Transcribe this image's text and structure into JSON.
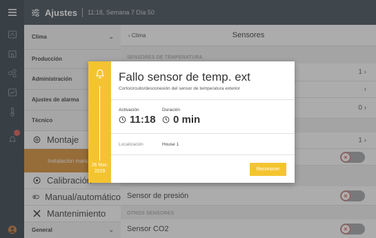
{
  "header": {
    "title": "Ajustes",
    "subtitle": "11:18, Semana 7 Día 50"
  },
  "menu": {
    "items": [
      {
        "label": "Clima"
      },
      {
        "label": "Producción"
      },
      {
        "label": "Administración"
      },
      {
        "label": "Ajustes de alarma"
      },
      {
        "label": "Técnico"
      }
    ],
    "tech_items": [
      {
        "label": "Montaje",
        "icon": "gear-icon"
      },
      {
        "label": "Instalación manual",
        "active": true
      },
      {
        "label": "Calibración",
        "icon": "crosshair-icon"
      },
      {
        "label": "Manual/automático",
        "icon": "toggle-icon"
      },
      {
        "label": "Mantenimiento",
        "icon": "tools-icon"
      }
    ],
    "general": {
      "label": "General"
    }
  },
  "main": {
    "back_label": "Clima",
    "title": "Sensores",
    "section_temp": "SENSORES DE TEMPERATURA",
    "temp_rows": [
      {
        "value": "1"
      },
      {
        "value": ""
      },
      {
        "value": "0"
      }
    ],
    "row_b_value": "1",
    "pressure_label": "Sensor de presión",
    "section_other": "OTROS SENSORES",
    "co2_label": "Sensor CO2",
    "toggle_off_symbol": "×"
  },
  "alarm": {
    "title": "Fallo sensor de temp. ext",
    "description": "Cortocircuito/desconexión del sensor de temperatura exterior",
    "activation_label": "Activación",
    "activation_value": "11:18",
    "duration_label": "Duración",
    "duration_value": "0 min",
    "location_label": "Localización",
    "location_value": "House 1",
    "date_day": "26 Nov.",
    "date_year": "2019",
    "acknowledge_label": "Reconocer"
  },
  "colors": {
    "alarm_yellow": "#f4c430",
    "active_orange": "#d88a2c",
    "header_dark": "#3a4750",
    "rail_dark": "#2e3b44",
    "alarm_red": "#d9534f"
  }
}
